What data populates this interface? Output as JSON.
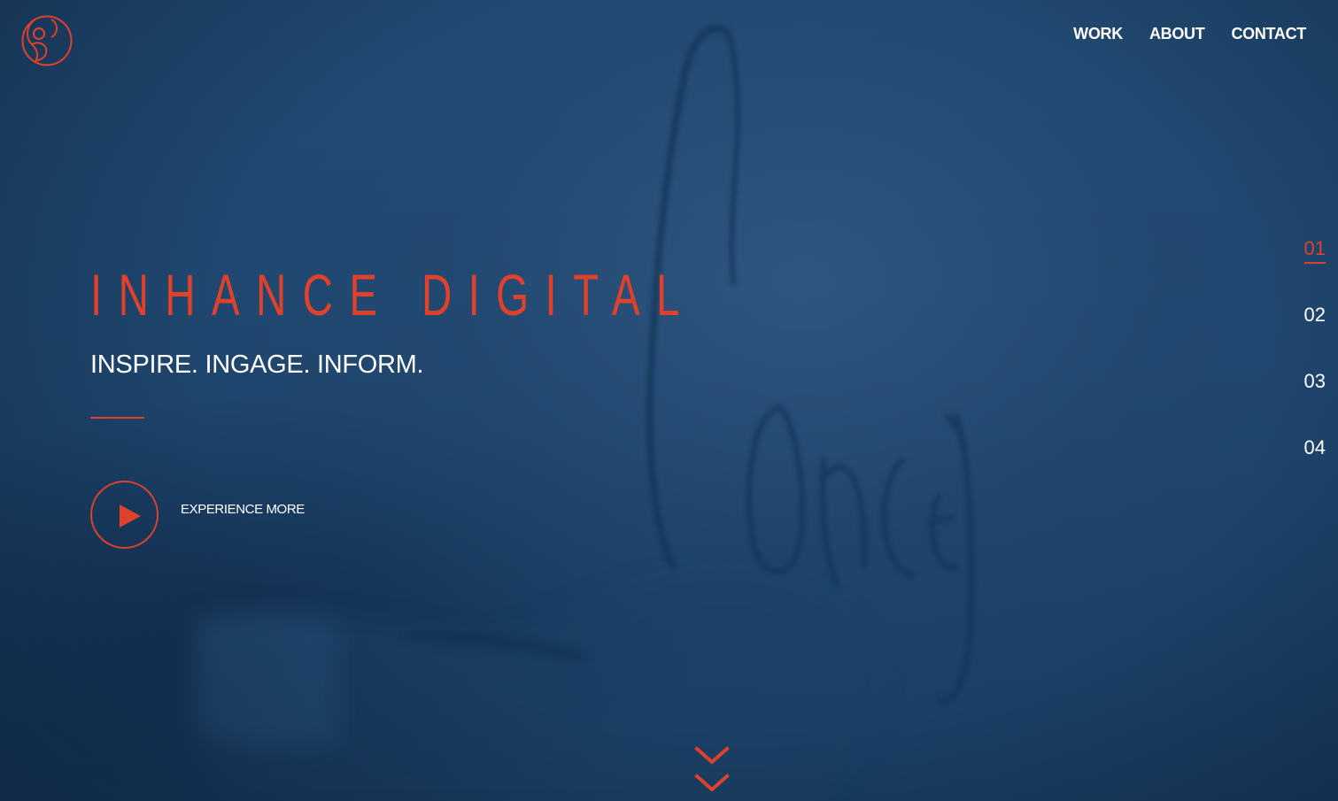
{
  "brand": {
    "name": "INHANCE DIGITAL",
    "accent_color": "#e0412a",
    "logo_icon": "inhance-logo-icon"
  },
  "nav": {
    "items": [
      {
        "label": "WORK"
      },
      {
        "label": "ABOUT"
      },
      {
        "label": "CONTACT"
      }
    ]
  },
  "hero": {
    "title": "INHANCE DIGITAL",
    "tagline": "INSPIRE. INGAGE. INFORM.",
    "cta_label": "EXPERIENCE MORE",
    "cta_icon": "play-icon"
  },
  "pager": {
    "items": [
      {
        "label": "01",
        "active": true
      },
      {
        "label": "02",
        "active": false
      },
      {
        "label": "03",
        "active": false
      },
      {
        "label": "04",
        "active": false
      }
    ]
  },
  "scroll": {
    "icon": "double-chevron-down-icon"
  },
  "background": {
    "base_color": "#1f466e"
  }
}
